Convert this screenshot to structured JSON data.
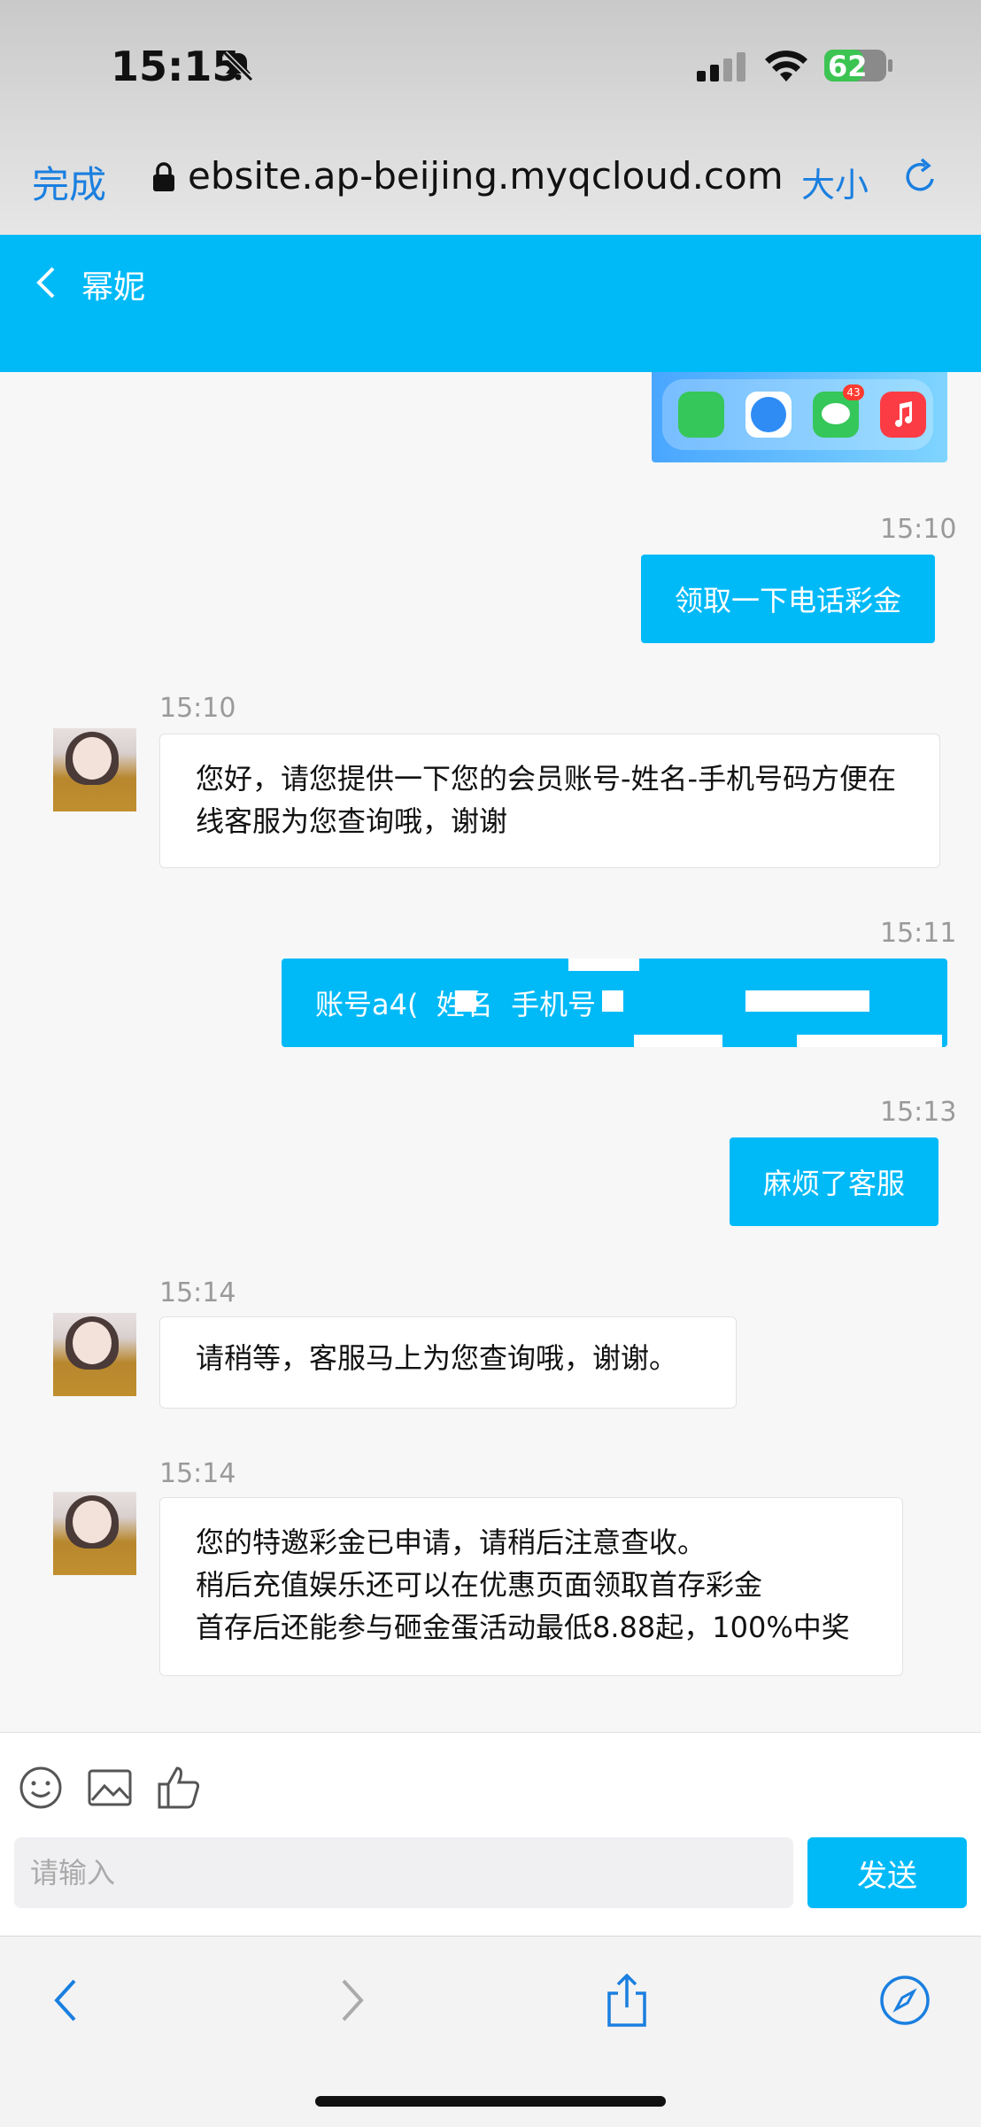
{
  "status_bar": {
    "time": "15:15",
    "battery": "62"
  },
  "browser": {
    "done_label": "完成",
    "url": "ebsite.ap-beijing.myqcloud.com",
    "size_label": "大小"
  },
  "chat": {
    "title": "幂妮",
    "messages": [
      {
        "time": "15:10",
        "text": "领取一下电话彩金"
      },
      {
        "time": "15:10",
        "text": "您好，请您提供一下您的会员账号-姓名-手机号码方便在线客服为您查询哦，谢谢"
      },
      {
        "time": "15:11",
        "text": "账号a4(  姓名  手机号"
      },
      {
        "time": "15:13",
        "text": "麻烦了客服"
      },
      {
        "time": "15:14",
        "text": "请稍等，客服马上为您查询哦，谢谢。"
      },
      {
        "time": "15:14",
        "lines": [
          "您的特邀彩金已申请，请稍后注意查收。",
          "稍后充值娱乐还可以在优惠页面领取首存彩金",
          "首存后还能参与砸金蛋活动最低8.88起，100%中奖"
        ]
      }
    ],
    "dock_badge": "43"
  },
  "composer": {
    "placeholder": "请输入",
    "send_label": "发送"
  },
  "colors": {
    "accent": "#00baf8",
    "link": "#1a7fe0"
  }
}
